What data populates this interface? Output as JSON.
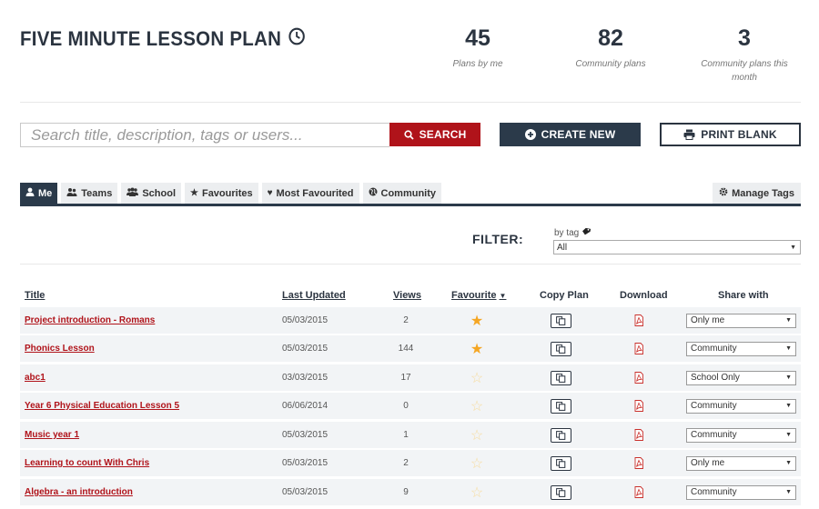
{
  "header": {
    "title": "FIVE MINUTE LESSON PLAN",
    "title_icon": "clock-icon",
    "stats": [
      {
        "value": "45",
        "label": "Plans by me"
      },
      {
        "value": "82",
        "label": "Community plans"
      },
      {
        "value": "3",
        "label": "Community plans this month"
      }
    ]
  },
  "search": {
    "placeholder": "Search title, description, tags or users...",
    "search_label": "SEARCH",
    "create_label": "CREATE NEW",
    "print_label": "PRINT BLANK"
  },
  "tabs": [
    {
      "label": "Me",
      "icon": "user-icon",
      "active": true
    },
    {
      "label": "Teams",
      "icon": "team-icon",
      "active": false
    },
    {
      "label": "School",
      "icon": "school-icon",
      "active": false
    },
    {
      "label": "Favourites",
      "icon": "star-icon",
      "active": false
    },
    {
      "label": "Most Favourited",
      "icon": "heart-icon",
      "active": false
    },
    {
      "label": "Community",
      "icon": "globe-icon",
      "active": false
    }
  ],
  "manage_tags_label": "Manage Tags",
  "filter": {
    "label": "FILTER:",
    "by_tag_label": "by tag",
    "selected": "All"
  },
  "table": {
    "columns": {
      "title": "Title",
      "last_updated": "Last Updated",
      "views": "Views",
      "favourite": "Favourite",
      "copy_plan": "Copy Plan",
      "download": "Download",
      "share_with": "Share with"
    },
    "rows": [
      {
        "title": "Project introduction - Romans",
        "date": "05/03/2015",
        "views": "2",
        "favourite": true,
        "share": "Only me"
      },
      {
        "title": "Phonics Lesson",
        "date": "05/03/2015",
        "views": "144",
        "favourite": true,
        "share": "Community"
      },
      {
        "title": "abc1",
        "date": "03/03/2015",
        "views": "17",
        "favourite": false,
        "share": "School Only"
      },
      {
        "title": "Year 6 Physical Education Lesson 5",
        "date": "06/06/2014",
        "views": "0",
        "favourite": false,
        "share": "Community"
      },
      {
        "title": "Music year 1",
        "date": "05/03/2015",
        "views": "1",
        "favourite": false,
        "share": "Community"
      },
      {
        "title": "Learning to count With Chris",
        "date": "05/03/2015",
        "views": "2",
        "favourite": false,
        "share": "Only me"
      },
      {
        "title": "Algebra - an introduction",
        "date": "05/03/2015",
        "views": "9",
        "favourite": false,
        "share": "Community"
      }
    ]
  },
  "colors": {
    "brand_red": "#b0131a",
    "navy": "#2b3a4a",
    "star_on": "#f5a623",
    "star_off": "#f7dca0"
  }
}
